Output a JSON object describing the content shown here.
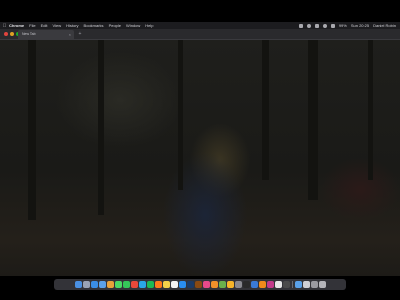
{
  "menubar": {
    "apple_icon": "apple-logo-icon",
    "app_name": "Chrome",
    "items": [
      "File",
      "Edit",
      "View",
      "History",
      "Bookmarks",
      "People",
      "Window",
      "Help"
    ],
    "status_icons": [
      "dropbox-icon",
      "cloud-icon",
      "bluetooth-icon",
      "wifi-icon",
      "volume-icon"
    ],
    "battery": "99%",
    "clock": "Sun 20:25",
    "user": "Daniel Robin"
  },
  "browser": {
    "tab_title": "New Tab",
    "tab_close": "×",
    "new_tab": "+"
  },
  "dock": {
    "apps": [
      {
        "name": "finder-icon",
        "color": "#4a90e2"
      },
      {
        "name": "launchpad-icon",
        "color": "#9aa3b5"
      },
      {
        "name": "safari-icon",
        "color": "#3a8ee6"
      },
      {
        "name": "mail-icon",
        "color": "#5aa0e8"
      },
      {
        "name": "photos-icon",
        "color": "#e8a23a"
      },
      {
        "name": "messages-icon",
        "color": "#4cd964"
      },
      {
        "name": "facetime-icon",
        "color": "#35c759"
      },
      {
        "name": "chrome-icon",
        "color": "#e8483a"
      },
      {
        "name": "skype-icon",
        "color": "#2aa6e6"
      },
      {
        "name": "spotify-icon",
        "color": "#1db954"
      },
      {
        "name": "firefox-icon",
        "color": "#ff7a1a"
      },
      {
        "name": "notes-icon",
        "color": "#f2d14a"
      },
      {
        "name": "calendar-icon",
        "color": "#f2f2f2"
      },
      {
        "name": "app-store-icon",
        "color": "#2a8ef0"
      },
      {
        "name": "photoshop-icon",
        "color": "#1a3a66"
      },
      {
        "name": "illustrator-icon",
        "color": "#8a4a12"
      },
      {
        "name": "itunes-icon",
        "color": "#e84a8a"
      },
      {
        "name": "books-icon",
        "color": "#f0902a"
      },
      {
        "name": "maps-icon",
        "color": "#6ab04c"
      },
      {
        "name": "sketch-icon",
        "color": "#f7b52a"
      },
      {
        "name": "system-preferences-icon",
        "color": "#8a8a90"
      },
      {
        "name": "terminal-icon",
        "color": "#2a2a2a"
      },
      {
        "name": "xcode-icon",
        "color": "#3a7ad6"
      },
      {
        "name": "vlc-icon",
        "color": "#f08a1a"
      },
      {
        "name": "affinity-icon",
        "color": "#c23a8a"
      },
      {
        "name": "textedit-icon",
        "color": "#e6e6e6"
      },
      {
        "name": "activity-monitor-icon",
        "color": "#4a4a4a"
      }
    ],
    "right": [
      {
        "name": "downloads-folder-icon",
        "color": "#5aa0e8"
      },
      {
        "name": "documents-stack-icon",
        "color": "#cfcfd4"
      },
      {
        "name": "screenshot-stack-icon",
        "color": "#9a9aa0"
      },
      {
        "name": "trash-icon",
        "color": "#b5b5ba"
      }
    ]
  }
}
